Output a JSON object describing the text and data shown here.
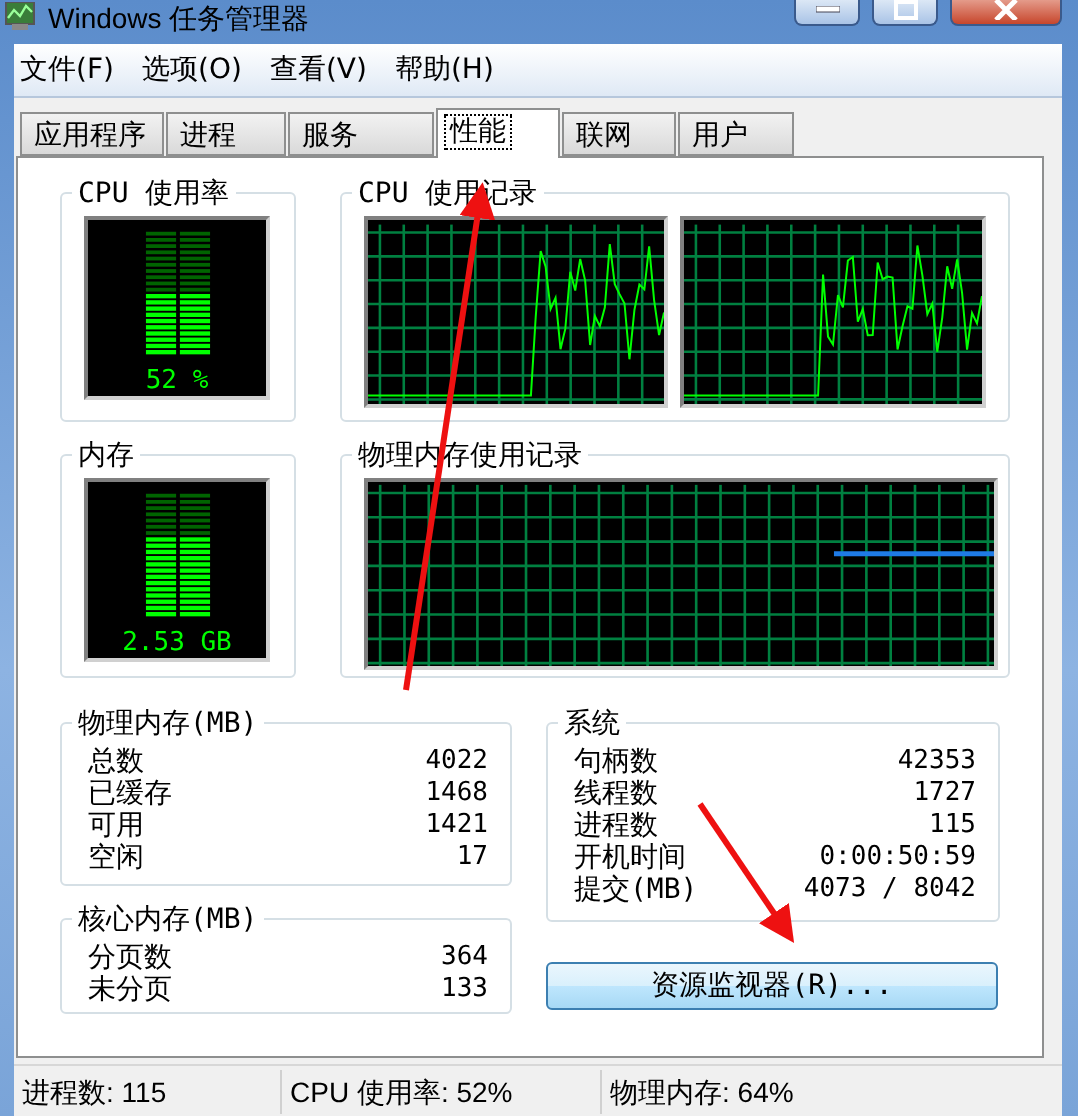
{
  "window": {
    "title": "Windows 任务管理器"
  },
  "menu": [
    "文件(F)",
    "选项(O)",
    "查看(V)",
    "帮助(H)"
  ],
  "tabs": [
    {
      "label": "应用程序",
      "selected": false
    },
    {
      "label": "进程",
      "selected": false
    },
    {
      "label": "服务",
      "selected": false
    },
    {
      "label": "性能",
      "selected": true
    },
    {
      "label": "联网",
      "selected": false
    },
    {
      "label": "用户",
      "selected": false
    }
  ],
  "cpu_usage": {
    "title": "CPU 使用率",
    "level": 0.52,
    "reading": "52 %"
  },
  "cpu_history": {
    "title": "CPU 使用记录"
  },
  "memory": {
    "title": "内存",
    "level": 0.64,
    "reading": "2.53 GB"
  },
  "memory_history": {
    "title": "物理内存使用记录"
  },
  "physical_memory": {
    "title": "物理内存(MB)",
    "rows": [
      {
        "label": "总数",
        "value": "4022"
      },
      {
        "label": "已缓存",
        "value": "1468"
      },
      {
        "label": "可用",
        "value": "1421"
      },
      {
        "label": "空闲",
        "value": "17"
      }
    ]
  },
  "kernel_memory": {
    "title": "核心内存(MB)",
    "rows": [
      {
        "label": "分页数",
        "value": "364"
      },
      {
        "label": "未分页",
        "value": "133"
      }
    ]
  },
  "system": {
    "title": "系统",
    "rows": [
      {
        "label": "句柄数",
        "value": "42353"
      },
      {
        "label": "线程数",
        "value": "1727"
      },
      {
        "label": "进程数",
        "value": "115"
      },
      {
        "label": "开机时间",
        "value": "0:00:50:59"
      },
      {
        "label": "提交(MB)",
        "value": "4073 / 8042"
      }
    ]
  },
  "resource_monitor_button": "资源监视器(R)...",
  "status_bar": [
    "进程数: 115",
    "CPU 使用率: 52%",
    "物理内存: 64%"
  ]
}
